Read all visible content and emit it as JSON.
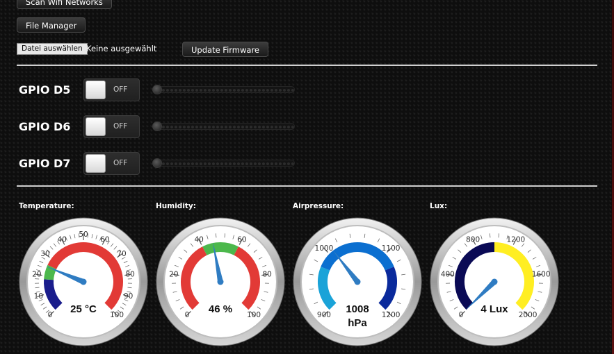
{
  "buttons": {
    "scan_wifi": "Scan Wifi Networks",
    "file_manager": "File Manager",
    "file_choose": "Datei auswählen",
    "file_status": "Keine ausgewählt",
    "update_firmware": "Update Firmware"
  },
  "gpios": [
    {
      "label": "GPIO D5",
      "state": "OFF",
      "pwm_level": 0
    },
    {
      "label": "GPIO D6",
      "state": "OFF",
      "pwm_level": 0
    },
    {
      "label": "GPIO D7",
      "state": "OFF",
      "pwm_level": 0
    }
  ],
  "gauges": [
    {
      "label": "Temperature:",
      "min": 0,
      "max": 100,
      "value": 25,
      "value_text": "25 °C",
      "value_text2": "",
      "ticks": [
        "0",
        "10",
        "20",
        "30",
        "40",
        "50",
        "60",
        "70",
        "80",
        "90",
        "100"
      ],
      "bands": [
        {
          "from": 0,
          "to": 18,
          "color": "#1a1d8c"
        },
        {
          "from": 18,
          "to": 26,
          "color": "#4cb84c"
        },
        {
          "from": 26,
          "to": 100,
          "color": "#e23a36"
        }
      ]
    },
    {
      "label": "Humidity:",
      "min": 0,
      "max": 100,
      "value": 46,
      "value_text": "46 %",
      "value_text2": "",
      "ticks": [
        "0",
        "20",
        "40",
        "60",
        "80",
        "100"
      ],
      "bands": [
        {
          "from": 0,
          "to": 40,
          "color": "#e23a36"
        },
        {
          "from": 40,
          "to": 60,
          "color": "#4cb84c"
        },
        {
          "from": 60,
          "to": 100,
          "color": "#e23a36"
        }
      ]
    },
    {
      "label": "Airpressure:",
      "min": 900,
      "max": 1200,
      "value": 1008,
      "value_text": "1008",
      "value_text2": "hPa",
      "ticks": [
        "900",
        "1000",
        "1100",
        "1200"
      ],
      "bands": [
        {
          "from": 900,
          "to": 975,
          "color": "#1aa3d8"
        },
        {
          "from": 975,
          "to": 1125,
          "color": "#0b6fd0"
        },
        {
          "from": 1125,
          "to": 1200,
          "color": "#0a2a9c"
        }
      ]
    },
    {
      "label": "Lux:",
      "min": 0,
      "max": 2000,
      "value": 4,
      "value_text": "4 Lux",
      "value_text2": "",
      "ticks": [
        "0",
        "400",
        "800",
        "1200",
        "1600",
        "2000"
      ],
      "bands": [
        {
          "from": 0,
          "to": 1000,
          "color": "#0a0a55"
        },
        {
          "from": 1000,
          "to": 2000,
          "color": "#ffee22"
        }
      ]
    }
  ],
  "colors": {
    "needle": "#2f7cc2",
    "divider": "#cfcfcf"
  }
}
